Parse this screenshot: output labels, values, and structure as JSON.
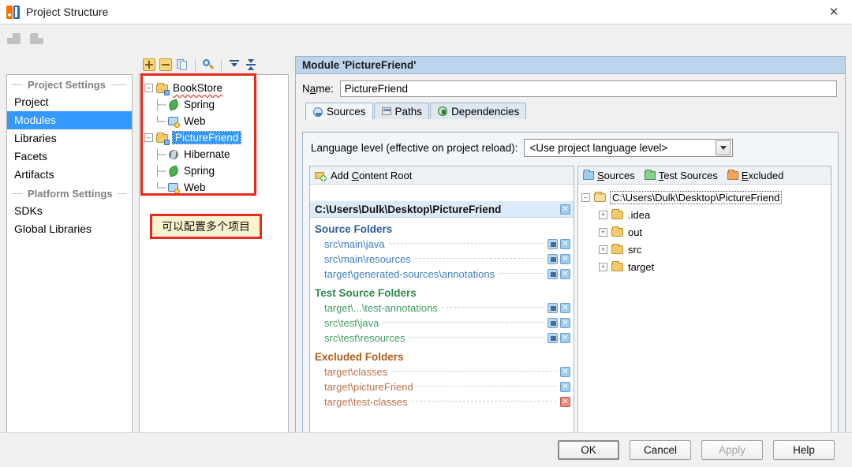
{
  "window": {
    "title": "Project Structure",
    "logo_icon": "intellij-idea-logo",
    "close_icon": "close-icon"
  },
  "nav": {
    "back_icon": "back-arrow-icon",
    "forward_icon": "forward-arrow-icon"
  },
  "settings": {
    "group_project": "Project Settings",
    "group_platform": "Platform Settings",
    "project_items": [
      "Project",
      "Modules",
      "Libraries",
      "Facets",
      "Artifacts"
    ],
    "platform_items": [
      "SDKs",
      "Global Libraries"
    ],
    "selected": "Modules",
    "selection_color": "#3399ff"
  },
  "module_toolbar": {
    "add_icon": "add-icon",
    "remove_icon": "remove-icon",
    "copy_icon": "copy-icon",
    "find_icon": "search-icon",
    "expand_icon": "expand-all-icon",
    "collapse_icon": "collapse-all-icon"
  },
  "module_tree": {
    "nodes": [
      {
        "label": "BookStore",
        "icon": "module-folder-icon",
        "depth": 0,
        "expanded": true,
        "selected": false,
        "spellcheck_squiggle": true
      },
      {
        "label": "Spring",
        "icon": "spring-leaf-icon",
        "depth": 1,
        "selected": false
      },
      {
        "label": "Web",
        "icon": "web-facet-icon",
        "depth": 1,
        "selected": false
      },
      {
        "label": "PictureFriend",
        "icon": "module-folder-icon",
        "depth": 0,
        "expanded": true,
        "selected": true
      },
      {
        "label": "Hibernate",
        "icon": "hibernate-icon",
        "depth": 1,
        "selected": false
      },
      {
        "label": "Spring",
        "icon": "spring-leaf-icon",
        "depth": 1,
        "selected": false
      },
      {
        "label": "Web",
        "icon": "web-facet-icon",
        "depth": 1,
        "selected": false
      }
    ]
  },
  "annotations": {
    "highlight_color": "#e8291c",
    "note_text": "可以配置多个项目",
    "note_background": "#fbf3cf"
  },
  "detail": {
    "header": "Module 'PictureFriend'",
    "header_color": "#bcd4ec",
    "name_label": "Name:",
    "name_value": "PictureFriend",
    "tabs": [
      {
        "label": "Sources",
        "icon": "sources-tab-icon",
        "active": true
      },
      {
        "label": "Paths",
        "icon": "paths-tab-icon",
        "active": false
      },
      {
        "label": "Dependencies",
        "icon": "dependencies-tab-icon",
        "active": false
      }
    ],
    "language_level_label": "Language level (effective on project reload):",
    "language_level_value": "<Use project language level>"
  },
  "content_pane": {
    "add_content_root": "Add Content Root",
    "content_root_path": "C:\\Users\\Dulk\\Desktop\\PictureFriend",
    "sections": [
      {
        "title": "Source Folders",
        "kind": "src",
        "rows": [
          {
            "path": "src\\main\\java",
            "has_edit": true,
            "has_remove": true,
            "remove_style": "blue"
          },
          {
            "path": "src\\main\\resources",
            "has_edit": true,
            "has_remove": true,
            "remove_style": "blue"
          },
          {
            "path": "target\\generated-sources\\annotations",
            "has_edit": true,
            "has_remove": true,
            "remove_style": "blue"
          }
        ]
      },
      {
        "title": "Test Source Folders",
        "kind": "test",
        "rows": [
          {
            "path": "target\\...\\test-annotations",
            "has_edit": true,
            "has_remove": true,
            "remove_style": "blue"
          },
          {
            "path": "src\\test\\java",
            "has_edit": true,
            "has_remove": true,
            "remove_style": "blue"
          },
          {
            "path": "src\\test\\resources",
            "has_edit": true,
            "has_remove": true,
            "remove_style": "blue"
          }
        ]
      },
      {
        "title": "Excluded Folders",
        "kind": "exc",
        "rows": [
          {
            "path": "target\\classes",
            "has_edit": false,
            "has_remove": true,
            "remove_style": "blue"
          },
          {
            "path": "target\\pictureFriend",
            "has_edit": false,
            "has_remove": true,
            "remove_style": "blue"
          },
          {
            "path": "target\\test-classes",
            "has_edit": false,
            "has_remove": true,
            "remove_style": "red"
          }
        ]
      }
    ]
  },
  "folder_tree": {
    "legend": [
      {
        "label": "Sources",
        "color": "#9fcdf2",
        "icon": "sources-folder-icon"
      },
      {
        "label": "Test Sources",
        "color": "#87d28b",
        "icon": "test-sources-folder-icon"
      },
      {
        "label": "Excluded",
        "color": "#f2a45e",
        "icon": "excluded-folder-icon"
      }
    ],
    "root": {
      "label": "C:\\Users\\Dulk\\Desktop\\PictureFriend",
      "expanded": true,
      "focused": true
    },
    "children": [
      {
        "label": ".idea",
        "expanded": false
      },
      {
        "label": "out",
        "expanded": false
      },
      {
        "label": "src",
        "expanded": false
      },
      {
        "label": "target",
        "expanded": false
      }
    ]
  },
  "footer": {
    "buttons": [
      {
        "label": "OK",
        "state": "default"
      },
      {
        "label": "Cancel",
        "state": "normal"
      },
      {
        "label": "Apply",
        "state": "disabled"
      },
      {
        "label": "Help",
        "state": "normal"
      }
    ]
  }
}
